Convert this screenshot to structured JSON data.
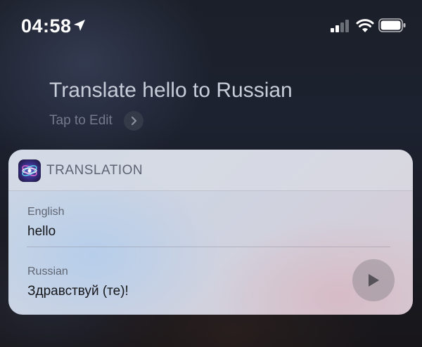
{
  "status_bar": {
    "time": "04:58",
    "icons": [
      "location-arrow-icon",
      "signal-icon",
      "wifi-icon",
      "battery-icon"
    ]
  },
  "siri": {
    "query": "Translate hello to Russian",
    "edit_label": "Tap to Edit"
  },
  "card": {
    "title": "TRANSLATION",
    "source": {
      "language": "English",
      "text": "hello"
    },
    "target": {
      "language": "Russian",
      "text": "Здравствуй (те)!"
    }
  },
  "colors": {
    "query_text": "#c7ccd9",
    "edit_text": "#747a8c",
    "card_title": "#5d6373"
  }
}
